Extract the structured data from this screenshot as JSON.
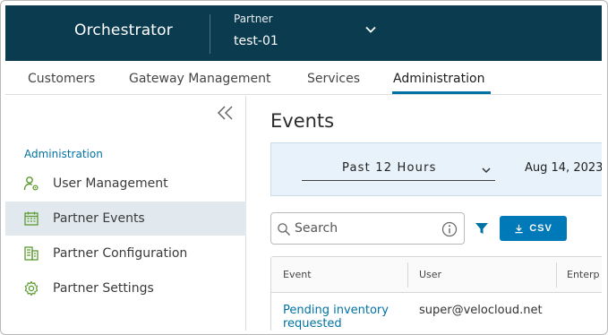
{
  "header": {
    "app_title": "Orchestrator",
    "partner_label": "Partner",
    "partner_value": "test-01"
  },
  "tabs": [
    {
      "label": "Customers",
      "active": false
    },
    {
      "label": "Gateway Management",
      "active": false
    },
    {
      "label": "Services",
      "active": false
    },
    {
      "label": "Administration",
      "active": true
    }
  ],
  "sidebar": {
    "section_title": "Administration",
    "items": [
      {
        "label": "User Management",
        "icon": "user-gear-icon",
        "active": false
      },
      {
        "label": "Partner Events",
        "icon": "calendar-icon",
        "active": true
      },
      {
        "label": "Partner Configuration",
        "icon": "building-icon",
        "active": false
      },
      {
        "label": "Partner Settings",
        "icon": "gear-icon",
        "active": false
      }
    ]
  },
  "main": {
    "title": "Events",
    "time_range": "Past 12 Hours",
    "date_text": "Aug 14, 2023",
    "search_placeholder": "Search",
    "csv_label": "CSV",
    "columns": [
      "Event",
      "User",
      "Enterp"
    ],
    "rows": [
      {
        "event": "Pending inventory requested",
        "user": "super@velocloud.net"
      }
    ]
  },
  "colors": {
    "header_bg": "#0b3b4f",
    "accent": "#0072a3",
    "button": "#0079b8",
    "active_item_bg": "#e1e9ef",
    "filter_bg": "#e8f2fa"
  }
}
